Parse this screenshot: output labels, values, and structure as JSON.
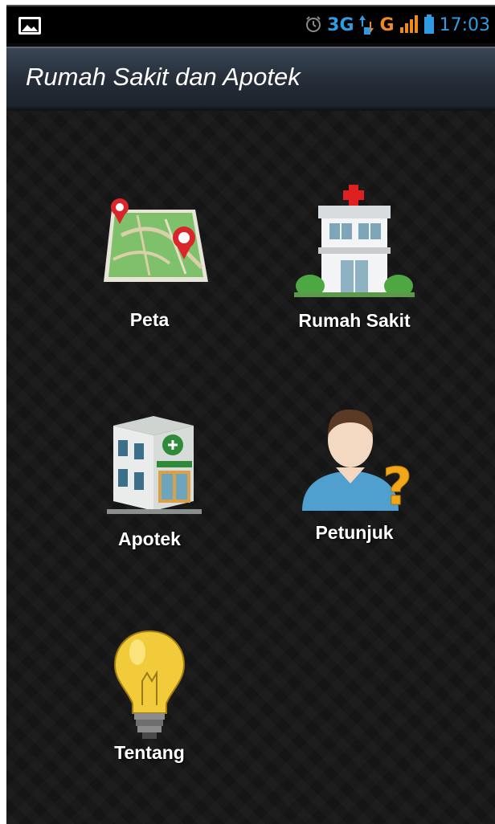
{
  "status_bar": {
    "network_3g": "3G",
    "network_g": "G",
    "time": "17:03",
    "icons": [
      "image-notification-icon",
      "alarm-icon",
      "data-transfer-icon",
      "signal-icon",
      "battery-icon"
    ]
  },
  "title_bar": {
    "title": "Rumah Sakit dan Apotek"
  },
  "menu": {
    "items": [
      {
        "label": "Peta",
        "icon": "map-icon"
      },
      {
        "label": "Rumah Sakit",
        "icon": "hospital-icon"
      },
      {
        "label": "Apotek",
        "icon": "pharmacy-icon"
      },
      {
        "label": "Petunjuk",
        "icon": "help-person-icon"
      },
      {
        "label": "Tentang",
        "icon": "lightbulb-icon"
      }
    ]
  },
  "colors": {
    "accent_blue": "#2f9be0",
    "accent_orange": "#f08a1e",
    "background": "#151515",
    "title_bar": "#252e39"
  }
}
